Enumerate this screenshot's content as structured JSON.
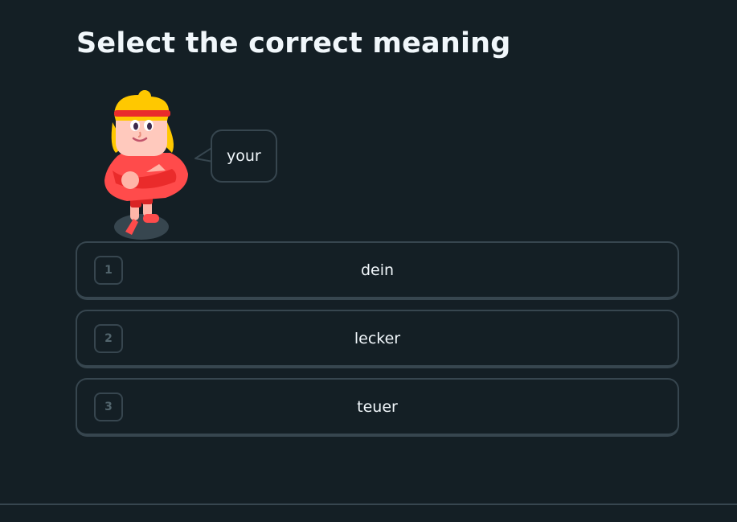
{
  "header": {
    "title": "Select the correct meaning"
  },
  "prompt": {
    "bubble_text": "your"
  },
  "options": [
    {
      "number": "1",
      "label": "dein"
    },
    {
      "number": "2",
      "label": "lecker"
    },
    {
      "number": "3",
      "label": "teuer"
    }
  ],
  "colors": {
    "background": "#141f25",
    "border": "#37464f",
    "text": "#f1f7fb",
    "muted_number": "#52656d",
    "character_shirt": "#ff4b4b",
    "character_hair": "#ffc800",
    "character_headband": "#ea2b2b"
  },
  "icons": {
    "character": "lily-character-icon"
  }
}
